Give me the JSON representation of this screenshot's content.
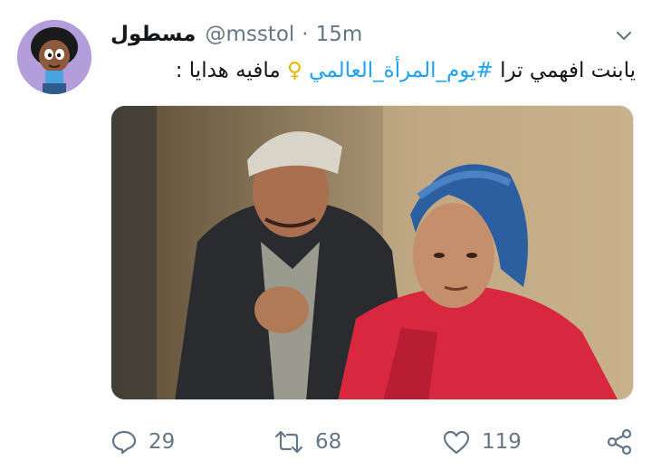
{
  "tweet": {
    "display_name": "مسطول",
    "handle": "@msstol",
    "separator": "·",
    "time": "15m",
    "text_before": "يابنت افهمي ترا ",
    "hashtag": "#يوم_المرأة_العالمي",
    "venus_symbol": "♀",
    "text_after": " مافيه هدايا :",
    "media_icon": "photo-still-two-people",
    "counts": {
      "replies": "29",
      "retweets": "68",
      "likes": "119"
    }
  },
  "colors": {
    "hashtag": "#1da1f2",
    "muted": "#657786",
    "text": "#14171a",
    "venus": "#e8b400"
  }
}
